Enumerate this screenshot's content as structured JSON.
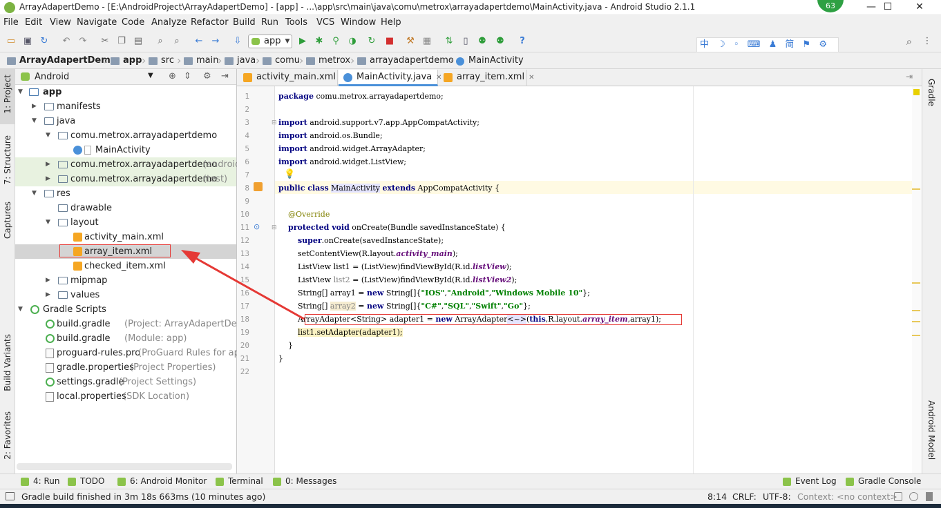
{
  "window": {
    "title": "ArrayAdapertDemo - [E:\\AndroidProject\\ArrayAdapertDemo] - [app] - ...\\app\\src\\main\\java\\comu\\metrox\\arrayadapertdemo\\MainActivity.java - Android Studio 2.1.1",
    "badge": "63",
    "minimize": "—",
    "maximize": "☐",
    "close": "✕"
  },
  "menu": [
    "File",
    "Edit",
    "View",
    "Navigate",
    "Code",
    "Analyze",
    "Refactor",
    "Build",
    "Run",
    "Tools",
    "VCS",
    "Window",
    "Help"
  ],
  "toolbar": {
    "run_config": "app",
    "ime_text": "中 ☽ ◦ ⌨ ♟ 简 ⚑ ⚙"
  },
  "breadcrumb": [
    "ArrayAdapertDemo",
    "app",
    "src",
    "main",
    "java",
    "comu",
    "metrox",
    "arrayadapertdemo",
    "MainActivity"
  ],
  "left_tools": {
    "project": "1: Project",
    "structure": "7: Structure",
    "captures": "Captures",
    "build_variants": "Build Variants",
    "favorites": "2: Favorites"
  },
  "right_tools": {
    "gradle": "Gradle",
    "android_model": "Android Model"
  },
  "project_panel": {
    "view_mode": "Android",
    "tree": [
      {
        "label": "app",
        "extra": ""
      },
      {
        "label": "manifests",
        "extra": ""
      },
      {
        "label": "java",
        "extra": ""
      },
      {
        "label": "comu.metrox.arrayadapertdemo",
        "extra": ""
      },
      {
        "label": "MainActivity",
        "extra": ""
      },
      {
        "label": "comu.metrox.arrayadapertdemo",
        "extra": "(androidTest)"
      },
      {
        "label": "comu.metrox.arrayadapertdemo",
        "extra": "(test)"
      },
      {
        "label": "res",
        "extra": ""
      },
      {
        "label": "drawable",
        "extra": ""
      },
      {
        "label": "layout",
        "extra": ""
      },
      {
        "label": "activity_main.xml",
        "extra": ""
      },
      {
        "label": "array_item.xml",
        "extra": ""
      },
      {
        "label": "checked_item.xml",
        "extra": ""
      },
      {
        "label": "mipmap",
        "extra": ""
      },
      {
        "label": "values",
        "extra": ""
      },
      {
        "label": "Gradle Scripts",
        "extra": ""
      },
      {
        "label": "build.gradle",
        "extra": "(Project: ArrayAdapertDemo)"
      },
      {
        "label": "build.gradle",
        "extra": "(Module: app)"
      },
      {
        "label": "proguard-rules.pro",
        "extra": "(ProGuard Rules for app)"
      },
      {
        "label": "gradle.properties",
        "extra": "(Project Properties)"
      },
      {
        "label": "settings.gradle",
        "extra": "(Project Settings)"
      },
      {
        "label": "local.properties",
        "extra": "(SDK Location)"
      }
    ]
  },
  "tabs": [
    {
      "label": "activity_main.xml",
      "close": "✕"
    },
    {
      "label": "MainActivity.java",
      "close": "✕"
    },
    {
      "label": "array_item.xml",
      "close": "✕"
    }
  ],
  "editor": {
    "line_numbers": [
      "1",
      "2",
      "3",
      "4",
      "5",
      "6",
      "7",
      "8",
      "9",
      "10",
      "11",
      "12",
      "13",
      "14",
      "15",
      "16",
      "17",
      "18",
      "19",
      "20",
      "21",
      "22"
    ]
  },
  "bottom_tools": [
    "4: Run",
    "TODO",
    "6: Android Monitor",
    "Terminal",
    "0: Messages",
    "Event Log",
    "Gradle Console"
  ],
  "status": {
    "message": "Gradle build finished in 3m 18s 663ms (10 minutes ago)",
    "position": "8:14",
    "line_sep": "CRLF:",
    "encoding": "UTF-8:",
    "context": "Context: <no context>"
  }
}
